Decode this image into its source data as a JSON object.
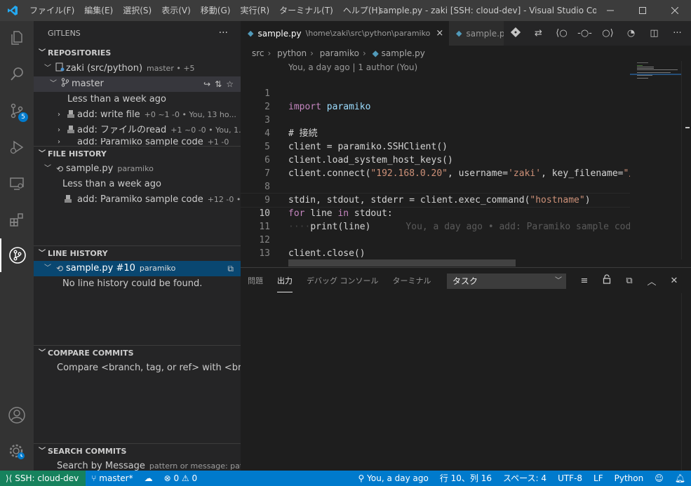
{
  "titlebar": {
    "menu": [
      "ファイル(F)",
      "編集(E)",
      "選択(S)",
      "表示(V)",
      "移動(G)",
      "実行(R)",
      "ターミナル(T)",
      "ヘルプ(H)"
    ],
    "title": "sample.py - zaki [SSH: cloud-dev] - Visual Studio Co..."
  },
  "activitybar": {
    "scm_badge": "5"
  },
  "sidebar": {
    "title": "GITLENS",
    "repositories": {
      "header": "REPOSITORIES",
      "repo_name": "zaki (src/python)",
      "repo_desc": "master  •  +5",
      "branch": "master",
      "group_label": "Less than a week ago",
      "commits": [
        {
          "label": "add: write file",
          "desc": "+0 ~1 -0  •  You, 13 ho..."
        },
        {
          "label": "add: ファイルのread",
          "desc": "+1 ~0 -0  •  You, 1..."
        },
        {
          "label": "add: Paramiko sample code",
          "desc": "+1 -0"
        }
      ]
    },
    "file_history": {
      "header": "FILE HISTORY",
      "file": "sample.py",
      "file_desc": "paramiko",
      "group_label": "Less than a week ago",
      "commit": {
        "label": "add: Paramiko sample code",
        "desc": "+12 -0  •..."
      }
    },
    "line_history": {
      "header": "LINE HISTORY",
      "file": "sample.py #10",
      "file_desc": "paramiko",
      "message": "No line history could be found."
    },
    "compare": {
      "header": "COMPARE COMMITS",
      "text": "Compare <branch, tag, or ref> with <bra..."
    },
    "search": {
      "header": "SEARCH COMMITS",
      "text": "Search by Message",
      "desc": "pattern or message: pat..."
    }
  },
  "tabs": [
    {
      "label": "sample.py",
      "path": "\\home\\zaki\\src\\python\\paramiko",
      "close": "×"
    },
    {
      "label": "sample.py"
    }
  ],
  "breadcrumb": [
    "src",
    "python",
    "paramiko",
    "sample.py"
  ],
  "editor": {
    "codelens": "You, a day ago | 1 author (You)",
    "lines": [
      {
        "n": "1"
      },
      {
        "n": "2"
      },
      {
        "n": "3"
      },
      {
        "n": "4"
      },
      {
        "n": "5"
      },
      {
        "n": "6"
      },
      {
        "n": "7"
      },
      {
        "n": "8"
      },
      {
        "n": "9"
      },
      {
        "n": "10"
      },
      {
        "n": "11"
      },
      {
        "n": "12"
      },
      {
        "n": "13"
      }
    ],
    "code": {
      "l1_kw": "import",
      "l1_mod": "paramiko",
      "l3": "# 接続",
      "l4a": "client",
      "l4b": " = paramiko.",
      "l4c": "SSHClient",
      "l4d": "()",
      "l5a": "client.",
      "l5b": "load_system_host_keys",
      "l5c": "()",
      "l6a": "client.",
      "l6b": "connect",
      "l6c": "(",
      "l6d": "\"192.168.0.20\"",
      "l6e": ", ",
      "l6f": "username",
      "l6g": "=",
      "l6h": "'zaki'",
      "l6i": ", ",
      "l6j": "key_filename",
      "l6k": "=",
      "l6l": "\"/h",
      "l8a": "stdin, stdout, stderr",
      "l8b": " = client.",
      "l8c": "exec_command",
      "l8d": "(",
      "l8e": "\"hostname\"",
      "l8f": ")",
      "l9a": "for",
      "l9b": " line ",
      "l9c": "in",
      "l9d": " stdout:",
      "l10a": "····",
      "l10b": "print",
      "l10c": "(line)",
      "l10_blame": "You, a day ago • add: Paramiko sample code",
      "l12a": "client.",
      "l12b": "close",
      "l12c": "()"
    }
  },
  "panel": {
    "tabs": [
      "問題",
      "出力",
      "デバッグ コンソール",
      "ターミナル"
    ],
    "active_tab": "出力",
    "dropdown": "タスク"
  },
  "statusbar": {
    "remote": "SSH: cloud-dev",
    "branch": "master*",
    "problems": "⊗ 0 ⚠ 0",
    "blame": "You, a day ago",
    "position": "行 10、列 16",
    "spaces": "スペース: 4",
    "encoding": "UTF-8",
    "eol": "LF",
    "language": "Python"
  },
  "colors": {
    "accent": "#007acc",
    "remote": "#16825d",
    "keyword": "#c586c0",
    "comment": "#6a9955",
    "string": "#ce9178",
    "function": "#dcdcaa",
    "variable": "#9cdcfe"
  }
}
